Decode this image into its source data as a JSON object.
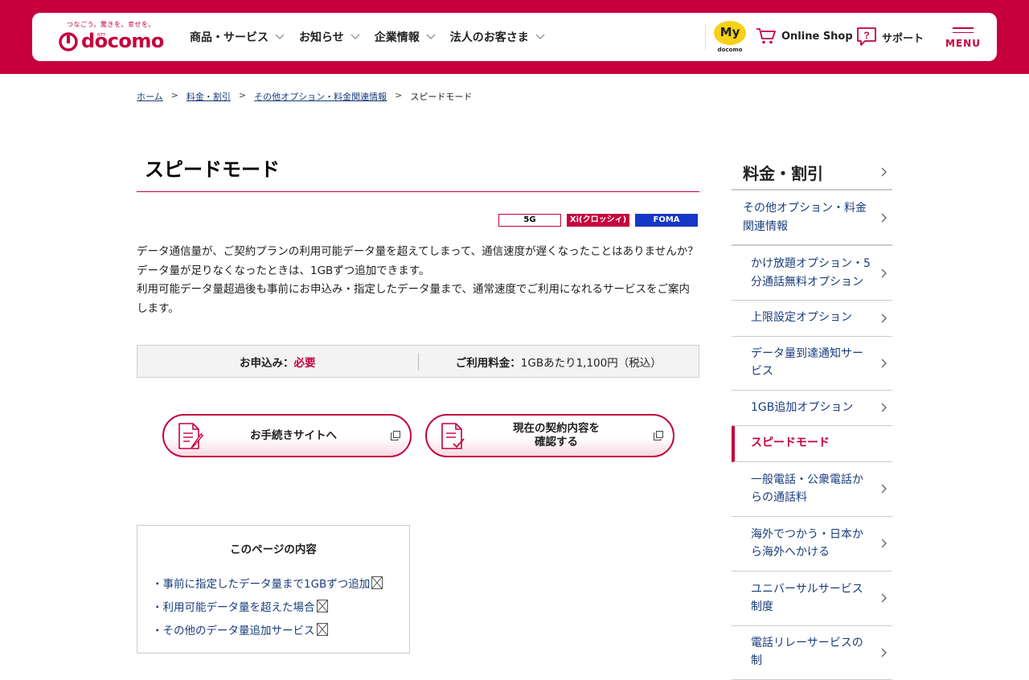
{
  "header": {
    "tagline": "つなごう。驚きを。幸せを。",
    "logo_ntt": "NTT",
    "logo_text": "docomo",
    "nav": [
      {
        "label": "商品・サービス"
      },
      {
        "label": "お知らせ"
      },
      {
        "label": "企業情報"
      },
      {
        "label": "法人のお客さま"
      }
    ],
    "my_label": "My",
    "my_sub": "docomo",
    "online_shop": "Online Shop",
    "support": "サポート",
    "menu": "MENU",
    "brand_color": "#c5003d"
  },
  "breadcrumb": [
    "ホーム",
    "料金・割引",
    "その他オプション・料金関連情報",
    "スピードモード"
  ],
  "main": {
    "title": "スピードモード",
    "tags": [
      "5G",
      "Xi(クロッシィ)",
      "FOMA"
    ],
    "lead": [
      "データ通信量が、ご契約プランの利用可能データ量を超えてしまって、通信速度が遅くなったことはありませんか？データ量が足りなくなったときは、1GBずつ追加できます。",
      "利用可能データ量超過後も事前にお申込み・指定したデータ量まで、通常速度でご利用になれるサービスをご案内します。"
    ],
    "info": {
      "apply_label": "お申込み：",
      "apply_value": "必要",
      "fee_label": "ご利用料金：",
      "fee_value": "1GBあたり1,100円（税込）"
    },
    "buttons": [
      {
        "label": "お手続きサイトへ"
      },
      {
        "label_line1": "現在の契約内容を",
        "label_line2": "確認する"
      }
    ],
    "toc": {
      "heading": "このページの内容",
      "items": [
        "・事前に指定したデータ量まで1GBずつ追加",
        "・利用可能データ量を超えた場合",
        "・その他のデータ量追加サービス"
      ]
    }
  },
  "sidebar": {
    "heading": "料金・割引",
    "items": [
      {
        "label": "その他オプション・料金関連情報"
      },
      {
        "label": "かけ放題オプション・5分通話無料オプション"
      },
      {
        "label": "上限設定オプション"
      },
      {
        "label": "データ量到達通知サービス"
      },
      {
        "label": "1GB追加オプション"
      },
      {
        "label": "スピードモード"
      },
      {
        "label": "一般電話・公衆電話からの通話料"
      },
      {
        "label": "海外でつかう・日本から海外へかける"
      },
      {
        "label": "ユニバーサルサービス制度"
      },
      {
        "label": "電話リレーサービスの制"
      }
    ]
  }
}
